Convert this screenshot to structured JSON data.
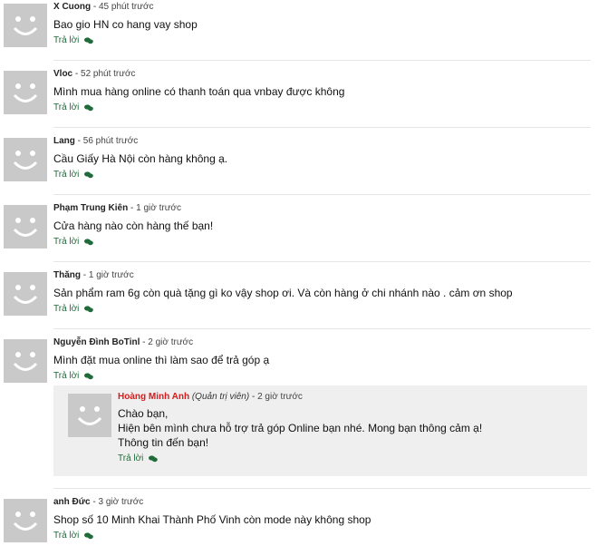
{
  "comments": [
    {
      "author": "X Cuong",
      "time": "45 phút trước",
      "text": "Bao gio HN co hang vay shop",
      "reply": "Trả lời"
    },
    {
      "author": "Vloc",
      "time": "52 phút trước",
      "text": "Mình mua hàng online có thanh toán qua vnbay được không",
      "reply": "Trả lời"
    },
    {
      "author": "Lang",
      "time": "56 phút trước",
      "text": "Cầu Giấy Hà Nội còn hàng không ạ.",
      "reply": "Trả lời"
    },
    {
      "author": "Phạm Trung Kiên",
      "time": "1 giờ trước",
      "text": "Cửa hàng nào còn hàng thế bạn!",
      "reply": "Trả lời"
    },
    {
      "author": "Thăng",
      "time": "1 giờ trước",
      "text": "Sản phẩm ram 6g còn quà tặng gì ko vậy shop ơi. Và còn hàng ở chi nhánh nào . cảm ơn shop",
      "reply": "Trả lời"
    },
    {
      "author": "Nguyễn Đình BoTinl",
      "time": "2 giờ trước",
      "text": "Mình đặt mua online thì làm sao để trả góp ạ",
      "reply": "Trả lời"
    },
    {
      "author": "anh Đức",
      "time": "3 giờ trước",
      "text": "Shop số 10 Minh Khai Thành Phố Vinh còn mode này không shop",
      "reply": "Trả lời"
    }
  ],
  "admin_reply": {
    "author": "Hoàng Minh Anh",
    "role": "(Quản trị viên)",
    "time": "2 giờ trước",
    "lines": [
      "Chào bạn,",
      "Hiện bên mình chưa hỗ trợ trả góp Online bạn nhé. Mong bạn thông cảm ạ!",
      "Thông tin đến bạn!"
    ],
    "reply": "Trả lời"
  },
  "separator": " - ",
  "colors": {
    "admin_name": "#d61c1c",
    "reply_link": "#1f6b3a",
    "avatar_bg": "#c9c9c9",
    "admin_box_bg": "#efefef"
  },
  "icons": {
    "avatar": "smiley-avatar-icon",
    "reply": "speech-bubbles-icon"
  }
}
